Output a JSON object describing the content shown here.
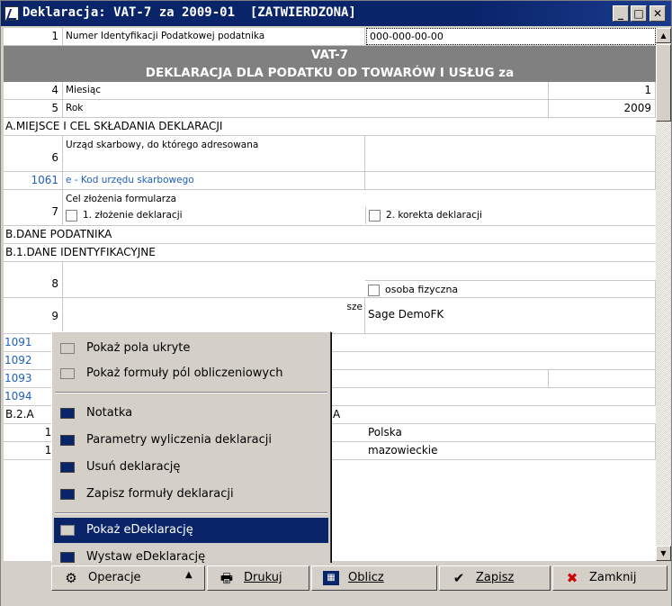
{
  "window": {
    "title": "Deklaracja: VAT-7 za 2009-01  [ZATWIERDZONA]",
    "controls": [
      "_",
      "□",
      "✕"
    ]
  },
  "form": {
    "r1": {
      "num": "1",
      "label": "Numer Identyfikacji Podatkowej podatnika",
      "value": "000-000-00-00"
    },
    "header": {
      "line1": "VAT-7",
      "line2": "DEKLARACJA DLA PODATKU OD TOWARÓW I USŁUG za"
    },
    "r4": {
      "num": "4",
      "label": "Miesiąc",
      "value": "1"
    },
    "r5": {
      "num": "5",
      "label": "Rok",
      "value": "2009"
    },
    "secA": "A.MIEJSCE I CEL SKŁADANIA DEKLARACJI",
    "r6": {
      "num": "6",
      "label": "Urząd skarbowy, do którego adresowana"
    },
    "r1061": {
      "num": "1061",
      "label": "e - Kod urzędu skarbowego"
    },
    "r7": {
      "num": "7",
      "label": "Cel złożenia formularza",
      "opt1": "1. złożenie deklaracji",
      "opt2": "2. korekta deklaracji"
    },
    "secB": "B.DANE PODATNIKA",
    "secB1": "B.1.DANE IDENTYFIKACYJNE",
    "r8": {
      "num": "8",
      "opt": "osoba fizyczna"
    },
    "r9": {
      "num": "9",
      "label_tail": "sze",
      "value": "Sage DemoFK"
    },
    "r1091": {
      "num": "1091"
    },
    "r1092": {
      "num": "1092"
    },
    "r1093": {
      "num": "1093"
    },
    "r1094": {
      "num": "1094"
    },
    "secB2": {
      "prefix": "B.2.A",
      "tail": "A"
    },
    "r10": {
      "num": "10",
      "value": "Polska"
    },
    "r11": {
      "num": "11",
      "value": "mazowieckie"
    }
  },
  "context_menu": {
    "items": [
      {
        "label": "Pokaż pola ukryte",
        "icon": "grey"
      },
      {
        "label": "Pokaż formuły pól obliczeniowych",
        "icon": "grey"
      },
      {
        "label": "Notatka",
        "icon": "navy"
      },
      {
        "label": "Parametry wyliczenia deklaracji",
        "icon": "navy"
      },
      {
        "label": "Usuń deklarację",
        "icon": "navy"
      },
      {
        "label": "Zapisz formuły deklaracji",
        "icon": "navy"
      },
      {
        "label": "Pokaż eDeklarację",
        "icon": "grey"
      },
      {
        "label": "Wystaw eDeklarację",
        "icon": "navy"
      }
    ]
  },
  "toolbar": {
    "operacje_label": "Operacje",
    "drukuj_label": "Drukuj",
    "oblicz_label": "Oblicz",
    "zapisz_label": "Zapisz",
    "zamknij_label": "Zamknij"
  },
  "colors": {
    "title_bg": "#0a246a",
    "header_bg": "#808080",
    "link_blue": "#1f5fbf",
    "selected": "#0a246a"
  }
}
